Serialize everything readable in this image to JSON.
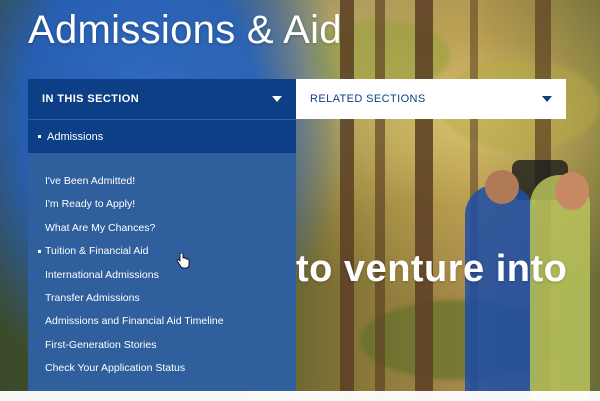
{
  "page": {
    "title": "Admissions & Aid",
    "hero_text": "to venture into"
  },
  "section_nav": {
    "in_this_section_label": "IN THIS SECTION",
    "related_sections_label": "RELATED SECTIONS",
    "current_item": "Admissions",
    "items": [
      {
        "label": "I've Been Admitted!",
        "active": false
      },
      {
        "label": "I'm Ready to Apply!",
        "active": false
      },
      {
        "label": "What Are My Chances?",
        "active": false
      },
      {
        "label": "Tuition & Financial Aid",
        "active": true
      },
      {
        "label": "International Admissions",
        "active": false
      },
      {
        "label": "Transfer Admissions",
        "active": false
      },
      {
        "label": "Admissions and Financial Aid Timeline",
        "active": false
      },
      {
        "label": "First-Generation Stories",
        "active": false
      },
      {
        "label": "Check Your Application Status",
        "active": false
      }
    ]
  },
  "colors": {
    "nav_dark_blue": "#0d3f87",
    "menu_blue": "#2f5f9c",
    "white": "#ffffff"
  },
  "icons": [
    "chevron-down-icon",
    "hand-pointer-cursor-icon"
  ]
}
